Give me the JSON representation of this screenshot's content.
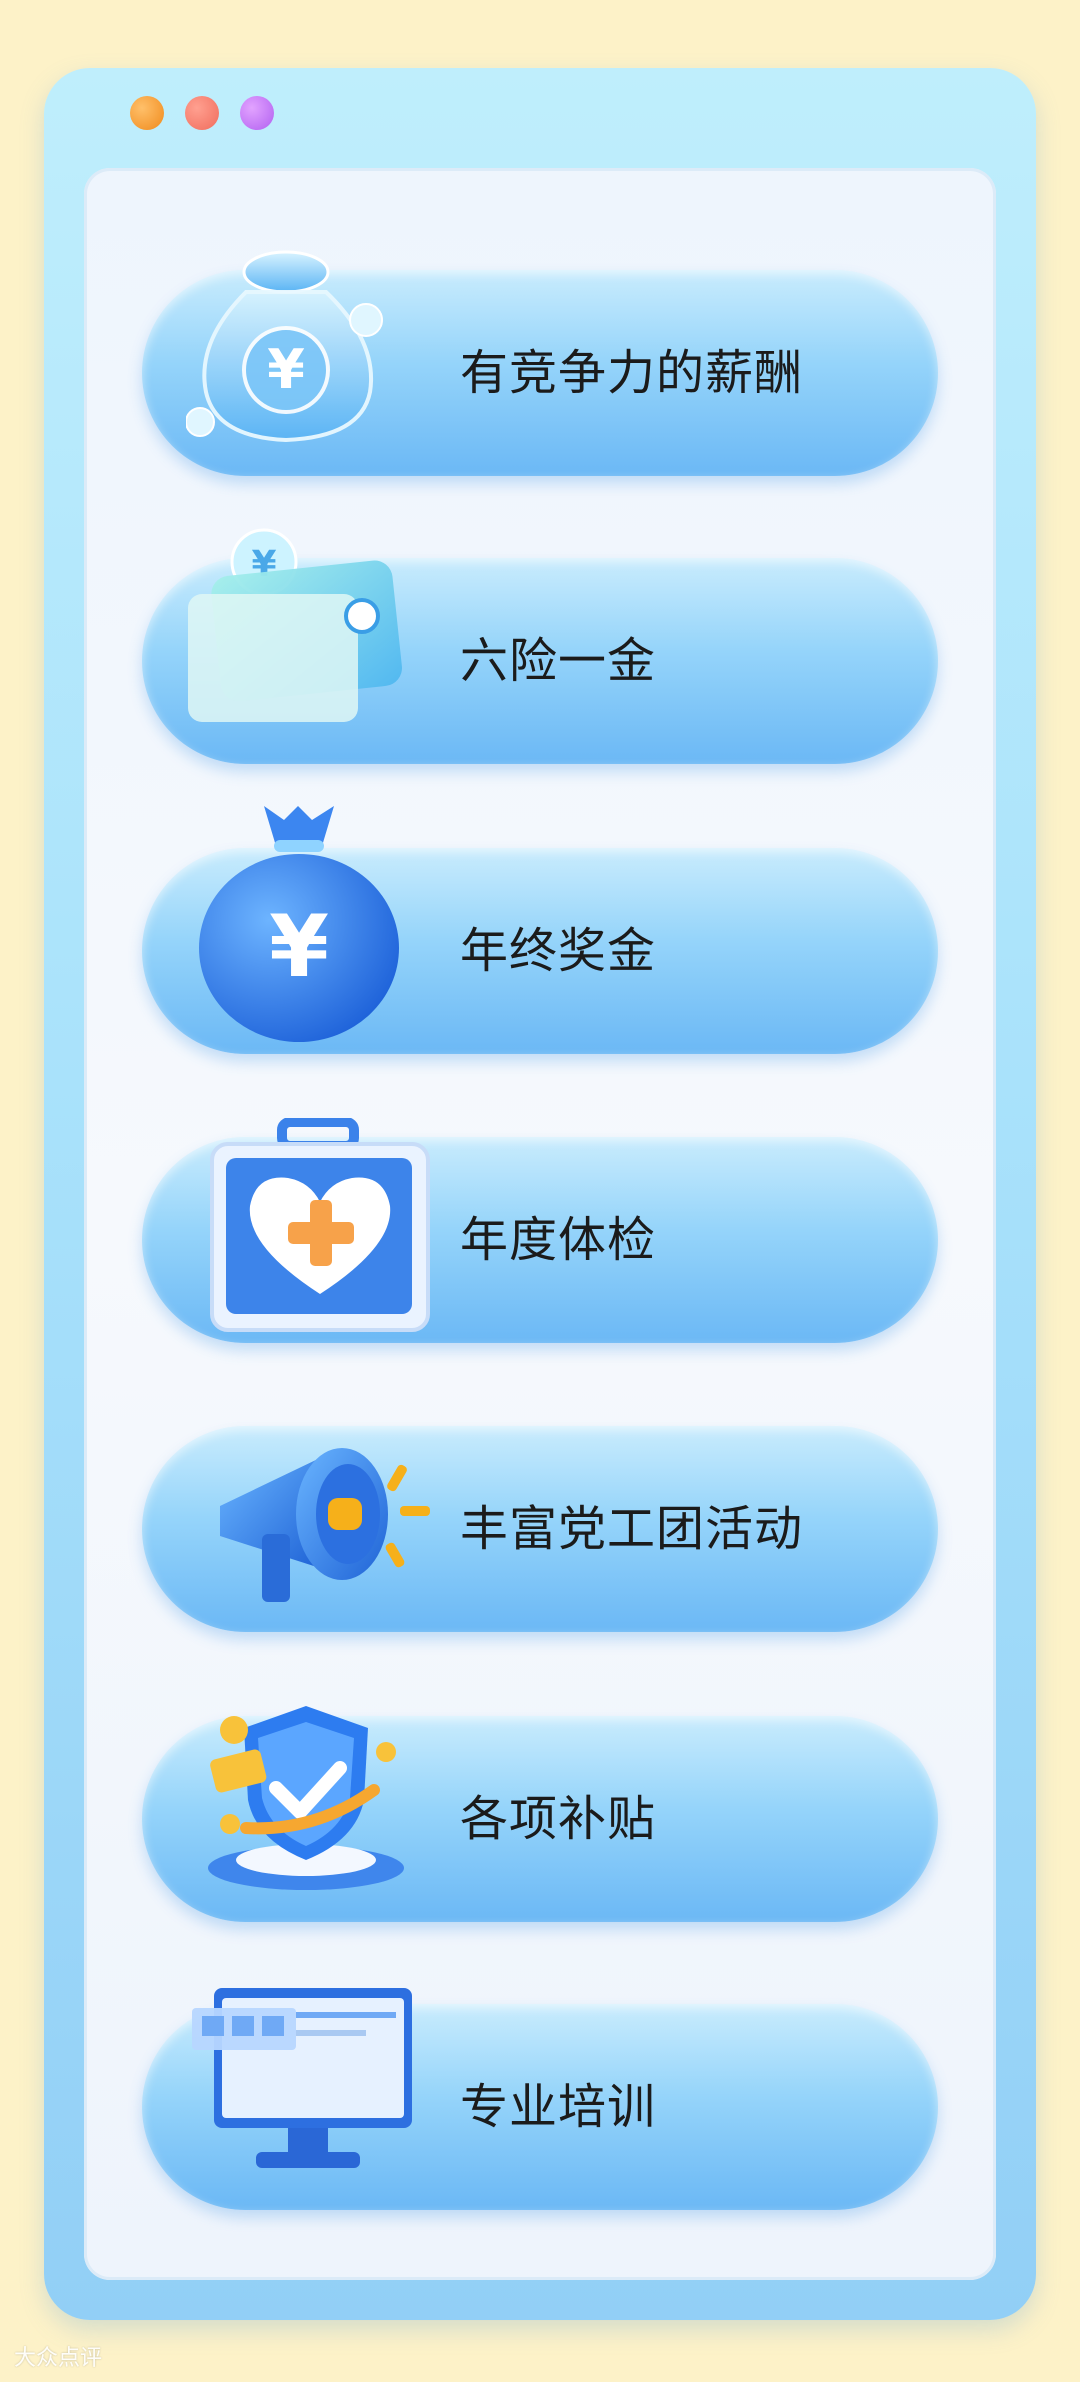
{
  "items": [
    {
      "label": "有竞争力的薪酬",
      "icon": "money-bag-icon"
    },
    {
      "label": "六险一金",
      "icon": "wallet-icon"
    },
    {
      "label": "年终奖金",
      "icon": "money-sack-icon"
    },
    {
      "label": "年度体检",
      "icon": "medical-kit-icon"
    },
    {
      "label": "丰富党工团活动",
      "icon": "megaphone-icon"
    },
    {
      "label": "各项补贴",
      "icon": "shield-check-icon"
    },
    {
      "label": "专业培训",
      "icon": "computer-monitor-icon"
    }
  ],
  "yen_symbol": "¥",
  "watermark": "大众点评",
  "colors": {
    "background": "#fdf2c8",
    "window": "#a9e2fb",
    "panel": "#f2f7fd",
    "pill": "#95d4fa",
    "accent_blue": "#2f7ee8",
    "accent_orange": "#f5a623"
  }
}
